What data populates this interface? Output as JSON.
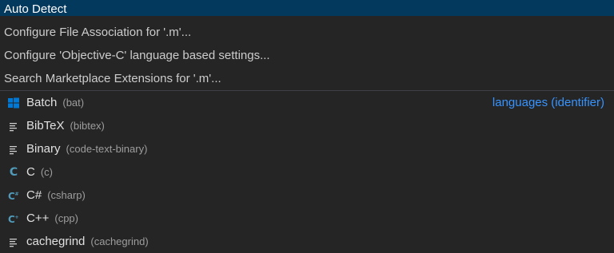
{
  "top_actions": [
    {
      "label": "Auto Detect"
    },
    {
      "label": "Configure File Association for '.m'..."
    },
    {
      "label": "Configure 'Objective-C' language based settings..."
    },
    {
      "label": "Search Marketplace Extensions for '.m'..."
    }
  ],
  "languages": [
    {
      "label": "Batch",
      "id": "(bat)",
      "icon": "windows-icon",
      "kind": "languages (identifier)"
    },
    {
      "label": "BibTeX",
      "id": "(bibtex)",
      "icon": "text-lines-icon"
    },
    {
      "label": "Binary",
      "id": "(code-text-binary)",
      "icon": "text-lines-icon"
    },
    {
      "label": "C",
      "id": "(c)",
      "icon": "c-language-icon"
    },
    {
      "label": "C#",
      "id": "(csharp)",
      "icon": "csharp-language-icon"
    },
    {
      "label": "C++",
      "id": "(cpp)",
      "icon": "cpp-language-icon"
    },
    {
      "label": "cachegrind",
      "id": "(cachegrind)",
      "icon": "text-lines-icon"
    }
  ],
  "colors": {
    "selection_bg": "#04395e",
    "accent": "#3794ff",
    "c_icon": "#519aba"
  }
}
